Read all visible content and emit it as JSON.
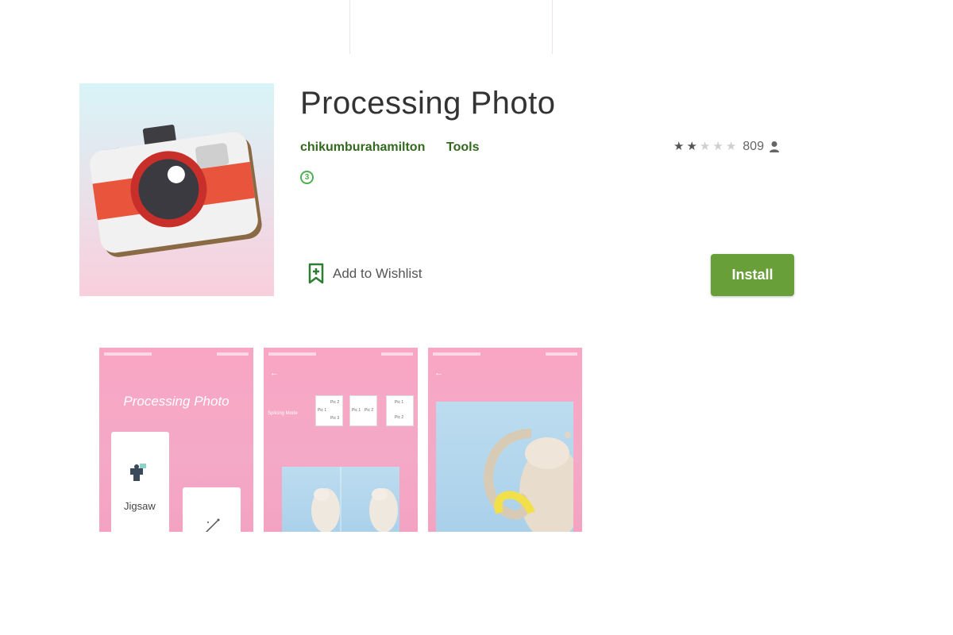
{
  "app": {
    "title": "Processing Photo",
    "developer": "chikumburahamilton",
    "category": "Tools",
    "content_rating": "3",
    "rating_stars": 2,
    "rating_max": 5,
    "rating_count": "809",
    "wishlist_label": "Add to Wishlist",
    "install_label": "Install"
  },
  "icons": {
    "app_icon": "camera-icon",
    "wishlist": "bookmark-add-icon",
    "reviewer": "person-icon",
    "star": "star-icon"
  },
  "colors": {
    "brand_green": "#689f38",
    "link_green": "#33691e",
    "badge_green": "#4caf50",
    "screenshot_pink": "#f8a6c4"
  },
  "screenshots": [
    {
      "title": "Processing Photo",
      "card1_label": "Jigsaw"
    },
    {
      "mode_label": "Splicing Mode",
      "cells": [
        "Pic 1",
        "Pic 2",
        "Pic 3",
        "Pic 1",
        "Pic 2",
        "Pic 1",
        "Pic 2"
      ]
    },
    {}
  ]
}
